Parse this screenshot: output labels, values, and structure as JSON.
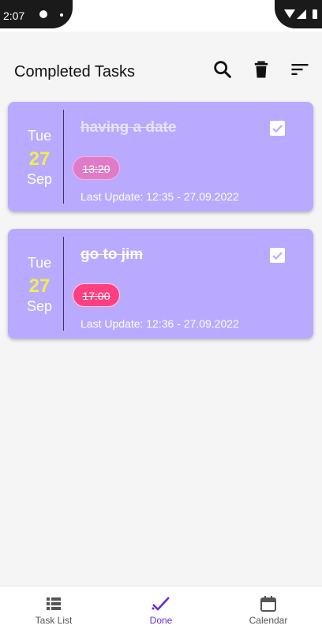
{
  "status_bar": {
    "time": "2:07"
  },
  "appbar": {
    "title": "Completed Tasks",
    "icons": [
      "search-icon",
      "delete-icon",
      "sort-icon"
    ]
  },
  "tasks": [
    {
      "day": "Tue",
      "date": "27",
      "month": "Sep",
      "title": "having a date",
      "title_color": "#e8e4f4",
      "time": "13:20",
      "chip_color": "#e07bc8",
      "last_update": "Last Update: 12:35 - 27.09.2022",
      "checked": true
    },
    {
      "day": "Tue",
      "date": "27",
      "month": "Sep",
      "title": "go to jim",
      "title_color": "#ffffff",
      "time": "17:00",
      "chip_color": "#ff3f7f",
      "last_update": "Last Update: 12:36 - 27.09.2022",
      "checked": true
    }
  ],
  "bottom_nav": {
    "items": [
      {
        "label": "Task List",
        "icon": "list-icon",
        "active": false
      },
      {
        "label": "Done",
        "icon": "done-check-icon",
        "active": true
      },
      {
        "label": "Calendar",
        "icon": "calendar-icon",
        "active": false
      }
    ]
  },
  "colors": {
    "card_bg": "#b9aaff",
    "accent": "#6b2bd8",
    "date_highlight": "#eef04a"
  }
}
